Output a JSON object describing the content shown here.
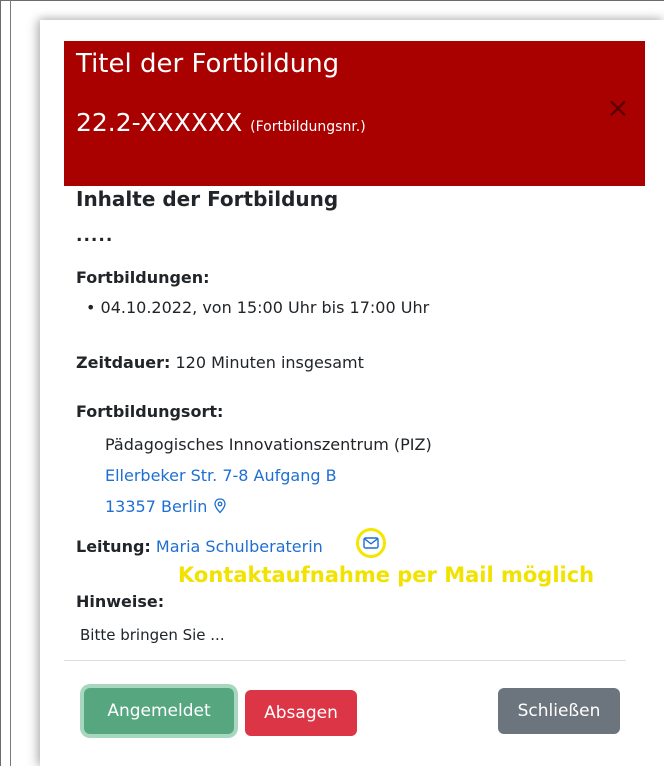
{
  "modal": {
    "title": "Titel der Fortbildung",
    "course_number": "22.2-XXXXXX",
    "course_number_hint": "(Fortbildungsnr.)",
    "close_symbol": "×"
  },
  "content": {
    "heading": "Inhalte der Fortbildung",
    "placeholder_dots": ".....",
    "sessions_label": "Fortbildungen:",
    "sessions": [
      "04.10.2022, von 15:00 Uhr bis 17:00 Uhr"
    ],
    "duration_label": "Zeitdauer:",
    "duration_value": "120 Minuten insgesamt",
    "location_label": "Fortbildungsort:",
    "location_name": "Pädagogisches Innovationszentrum (PIZ)",
    "location_street": "Ellerbeker Str. 7-8 Aufgang B",
    "location_city": "13357 Berlin",
    "lead_label": "Leitung:",
    "lead_name": "Maria Schulberaterin",
    "notes_label": "Hinweise:",
    "notes_value": "Bitte bringen Sie ..."
  },
  "annotation": "Kontaktaufnahme per Mail möglich",
  "buttons": {
    "registered": "Angemeldet",
    "cancel": "Absagen",
    "close": "Schließen"
  },
  "icons": {
    "map_pin": "map-pin-icon",
    "mail": "mail-icon",
    "close": "close-icon"
  },
  "colors": {
    "header_bg": "#a90000",
    "link": "#1f6fd1",
    "annotation": "#f2e200",
    "btn_registered": "#56a77f",
    "btn_cancel": "#dc3545",
    "btn_close": "#6c757d"
  }
}
